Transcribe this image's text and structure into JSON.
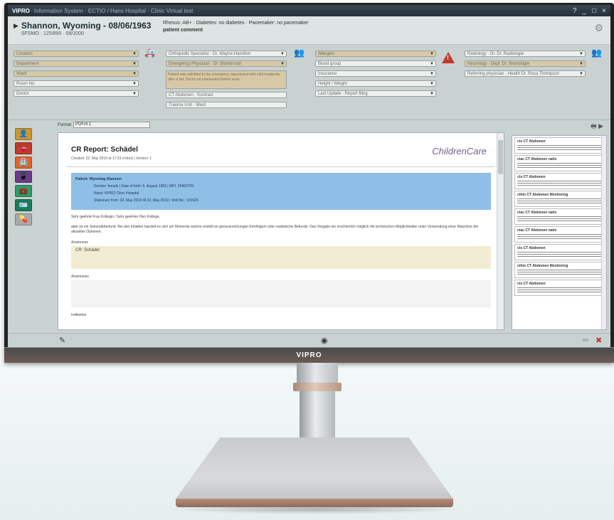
{
  "brand": "VIPRO",
  "titlebar": {
    "app_name": "VIPRO",
    "subtitle": "Information System · ECTIO / Hans Hospital · Clinic Virtual test",
    "controls": [
      "?",
      "_",
      "□",
      "×"
    ]
  },
  "patient": {
    "name": "Shannon, Wyoming - 08/06/1963",
    "sub": "SFSMO · 125/890 · 08/1000",
    "details_line1": "Rhesus: AB+ · Diabetes: no diabetes · Pacemaker: no pacemaker",
    "details_line2": "patient comment"
  },
  "form": {
    "left_fields": [
      "Location",
      "Department",
      "Ward",
      "Room No.",
      "Doctor"
    ],
    "mid_fields": [
      "Orthopedic Specialist · Dr. Wayne·Hamilton",
      "Emergency Physician · Dr. Blumenson"
    ],
    "mid_note": "Patient was admitted to the emergency department with mild headache after a fall. Doctor recommended further tests.",
    "mid_extra": [
      "CT Abdomen · Kontrast",
      "Trauma Unit · Ward"
    ],
    "right_mid_fields": [
      "Allergies",
      "Blood group",
      "Insurance",
      "Height / Weight",
      "Last Update · Report filing"
    ],
    "far_right_fields": [
      "Radiology · Dr. Dr. Radiologie",
      "Neurology · Dept. Dr. Neurologie",
      "Referring physician · Health Dr. Rosa Thompson"
    ]
  },
  "nav": {
    "buttons": [
      {
        "icon": "person-icon",
        "color": "#c9962d"
      },
      {
        "icon": "car-icon",
        "color": "#c0392b"
      },
      {
        "icon": "hospital-icon",
        "color": "#e0622a"
      },
      {
        "icon": "phone-icon",
        "color": "#6b3a8a"
      },
      {
        "icon": "medical-bag-icon",
        "color": "#2f9a6a"
      },
      {
        "icon": "card-icon",
        "color": "#1b7a5a"
      },
      {
        "icon": "pill-icon",
        "color": "#a9a9a9"
      }
    ]
  },
  "toolbar": {
    "label": "Format",
    "select_value": "PDF/A 1"
  },
  "report": {
    "title": "CR Report: Schädel",
    "meta": "Created: 22. May 2019 at 17:23 o'clock | Version: 1",
    "logo_a": "ChildrenCare",
    "patient_label": "Patient:",
    "patient_name": "Wyoming Shannon",
    "patient_line1": "Gender: female | Date of birth: 6. August 1963 | MPI: 29460709",
    "patient_line2": "Ward: VIPRO Clinic Hospital",
    "patient_line3": "Stationary from: 20. May 2019 till 22. May 2019 | Visit No.: 101524",
    "greeting": "Sehr geehrte Frau Kollegin / Sehr geehrter Herr Kollege,",
    "body": "aber ist ein Sekundärbefund. Bei den Inhalten handelt es sich um Momente welche erstellt an genussreichungen Erhöhigem oder realistische Befunde. Das Vorgabe ein erschienlich möglich die technischen Möglichkeiten unter Verwendung einer Maschine der aktuellen Optionen.",
    "section1_label": "Anamnese",
    "section1_value": "CR: Schädel",
    "section2_label": "Anamnesis",
    "section3_label": "Indikation"
  },
  "related_reports": [
    "cts CT Abdomen",
    "ctac CT Abdomen nativ",
    "cts CT Abdomen",
    "cthm CT Abdomen Monitoring",
    "ctac CT Abdomen nativ",
    "ctac CT Abdomen nativ",
    "cts CT Abdomen",
    "cthm CT Abdomen Monitoring",
    "cts CT Abdomen"
  ]
}
